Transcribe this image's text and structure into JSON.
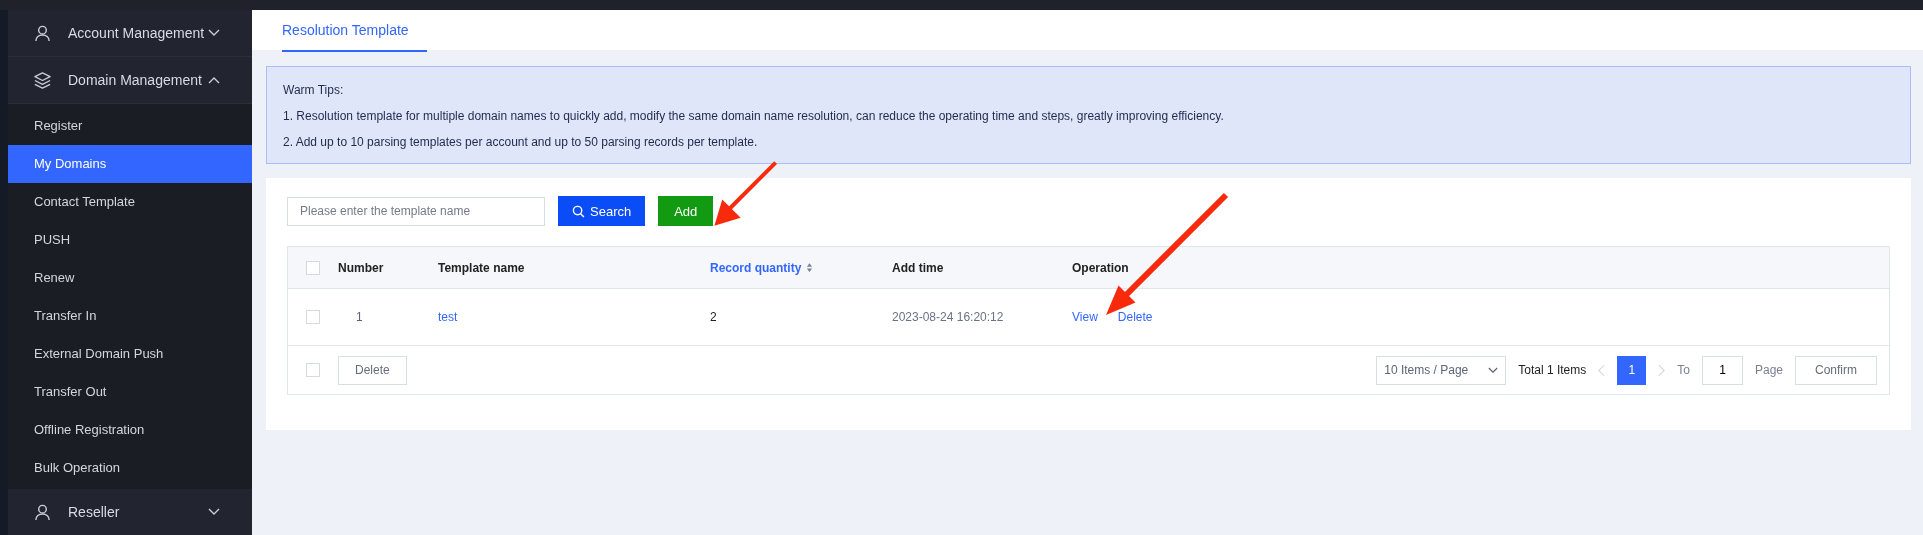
{
  "sidebar": {
    "groups": [
      {
        "label": "Account Management",
        "expanded": false
      },
      {
        "label": "Domain Management",
        "expanded": true,
        "items": [
          {
            "label": "Register",
            "selected": false
          },
          {
            "label": "My Domains",
            "selected": true
          },
          {
            "label": "Contact Template",
            "selected": false
          },
          {
            "label": "PUSH",
            "selected": false
          },
          {
            "label": "Renew",
            "selected": false
          },
          {
            "label": "Transfer In",
            "selected": false
          },
          {
            "label": "External Domain Push",
            "selected": false
          },
          {
            "label": "Transfer Out",
            "selected": false
          },
          {
            "label": "Offline Registration",
            "selected": false
          },
          {
            "label": "Bulk Operation",
            "selected": false
          }
        ]
      },
      {
        "label": "Reseller",
        "expanded": false
      }
    ]
  },
  "tabs": [
    {
      "label": "Resolution Template",
      "selected": true
    }
  ],
  "tips": {
    "title": "Warm Tips:",
    "lines": [
      "1. Resolution template for multiple domain names to quickly add, modify the same domain name resolution, can reduce the operating time and steps, greatly improving efficiency.",
      "2. Add up to 10 parsing templates per account and up to 50 parsing records per template."
    ]
  },
  "search": {
    "placeholder": "Please enter the template name",
    "button": "Search",
    "add": "Add"
  },
  "table": {
    "all_checked": false,
    "columns": [
      {
        "label": "Number",
        "sortable": false
      },
      {
        "label": "Template name",
        "sortable": false
      },
      {
        "label": "Record quantity",
        "sortable": true
      },
      {
        "label": "Add time",
        "sortable": false
      },
      {
        "label": "Operation",
        "sortable": false
      }
    ],
    "rows": [
      {
        "checked": false,
        "number": "1",
        "name": "test",
        "records": "2",
        "time": "2023-08-24 16:20:12",
        "actions": [
          "View",
          "Delete"
        ]
      }
    ],
    "footer": {
      "checked": false,
      "delete": "Delete"
    }
  },
  "pagination": {
    "page_size": "10 Items / Page",
    "total": "Total 1 Items",
    "pages": [
      {
        "label": "1",
        "selected": true
      }
    ],
    "to": "To",
    "page_input": "1",
    "page": "Page",
    "confirm": "Confirm"
  }
}
